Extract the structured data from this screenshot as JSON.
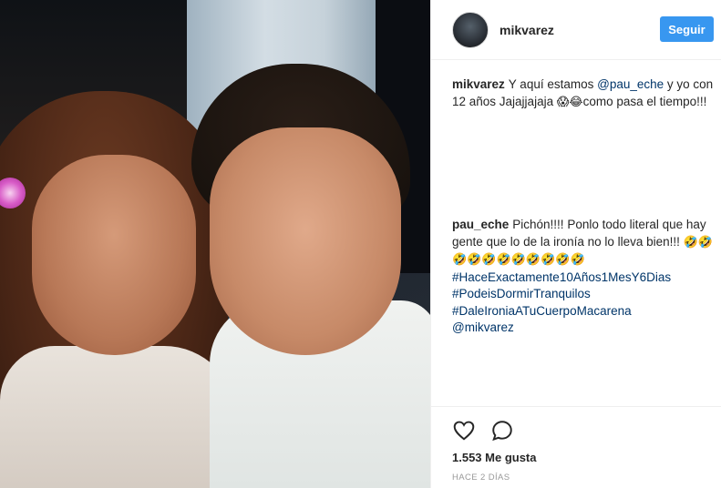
{
  "post": {
    "photo_alt": "photo",
    "author": "mikvarez",
    "follow_label": "Seguir"
  },
  "caption": {
    "user": "mikvarez",
    "text_before": "Y aquí estamos ",
    "mention": "@pau_eche",
    "text_after": " y yo con 12 años Jajajjajaja ",
    "emojis": "😱😂",
    "text_end": "como pasa el tiempo!!!"
  },
  "reply": {
    "user": "pau_eche",
    "text": "Pichón!!!! Ponlo todo literal que hay gente que lo de la ironía no lo lleva bien!!! ",
    "emojis": "🤣🤣🤣🤣🤣🤣🤣🤣🤣🤣🤣",
    "tags": [
      "#HaceExactamente10Años1MesY6Dias",
      "#PodeisDormirTranquilos",
      "#DaleIroniaATuCuerpoMacarena",
      "@mikvarez"
    ]
  },
  "footer": {
    "likes": "1.553 Me gusta",
    "time": "HACE 2 DÍAS"
  },
  "colors": {
    "accent": "#3897f0",
    "link": "#003569",
    "muted": "#999999"
  }
}
